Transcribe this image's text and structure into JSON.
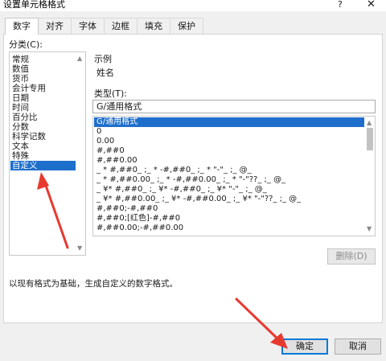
{
  "window": {
    "title": "设置单元格格式",
    "help": "?",
    "close": "✕"
  },
  "tabs": [
    "数字",
    "对齐",
    "字体",
    "边框",
    "填充",
    "保护"
  ],
  "category": {
    "label": "分类(C):",
    "items": [
      "常规",
      "数值",
      "货币",
      "会计专用",
      "日期",
      "时间",
      "百分比",
      "分数",
      "科学记数",
      "文本",
      "特殊",
      "自定义"
    ],
    "selected": "自定义"
  },
  "sample": {
    "label": "示例",
    "value": "姓名"
  },
  "type": {
    "label": "类型(T):",
    "value": "G/通用格式",
    "options": [
      "G/通用格式",
      "0",
      "0.00",
      "#,##0",
      "#,##0.00",
      "_ * #,##0_ ;_ * -#,##0_ ;_ * \"-\"_ ;_ @_",
      "_ * #,##0.00_ ;_ * -#,##0.00_ ;_ * \"-\"??_ ;_ @_",
      "_ ¥* #,##0_ ;_ ¥* -#,##0_ ;_ ¥* \"-\"_ ;_ @_",
      "_ ¥* #,##0.00_ ;_ ¥* -#,##0.00_ ;_ ¥* \"-\"??_ ;_ @_",
      "#,##0;-#,##0",
      "#,##0;[红色]-#,##0",
      "#,##0.00;-#,##0.00"
    ],
    "selected": "G/通用格式"
  },
  "buttons": {
    "delete": "删除(D)",
    "ok": "确定",
    "cancel": "取消"
  },
  "description": "以现有格式为基础，生成自定义的数字格式。",
  "colors": {
    "selection": "#1e6fcc",
    "annotation": "#e8392f"
  }
}
